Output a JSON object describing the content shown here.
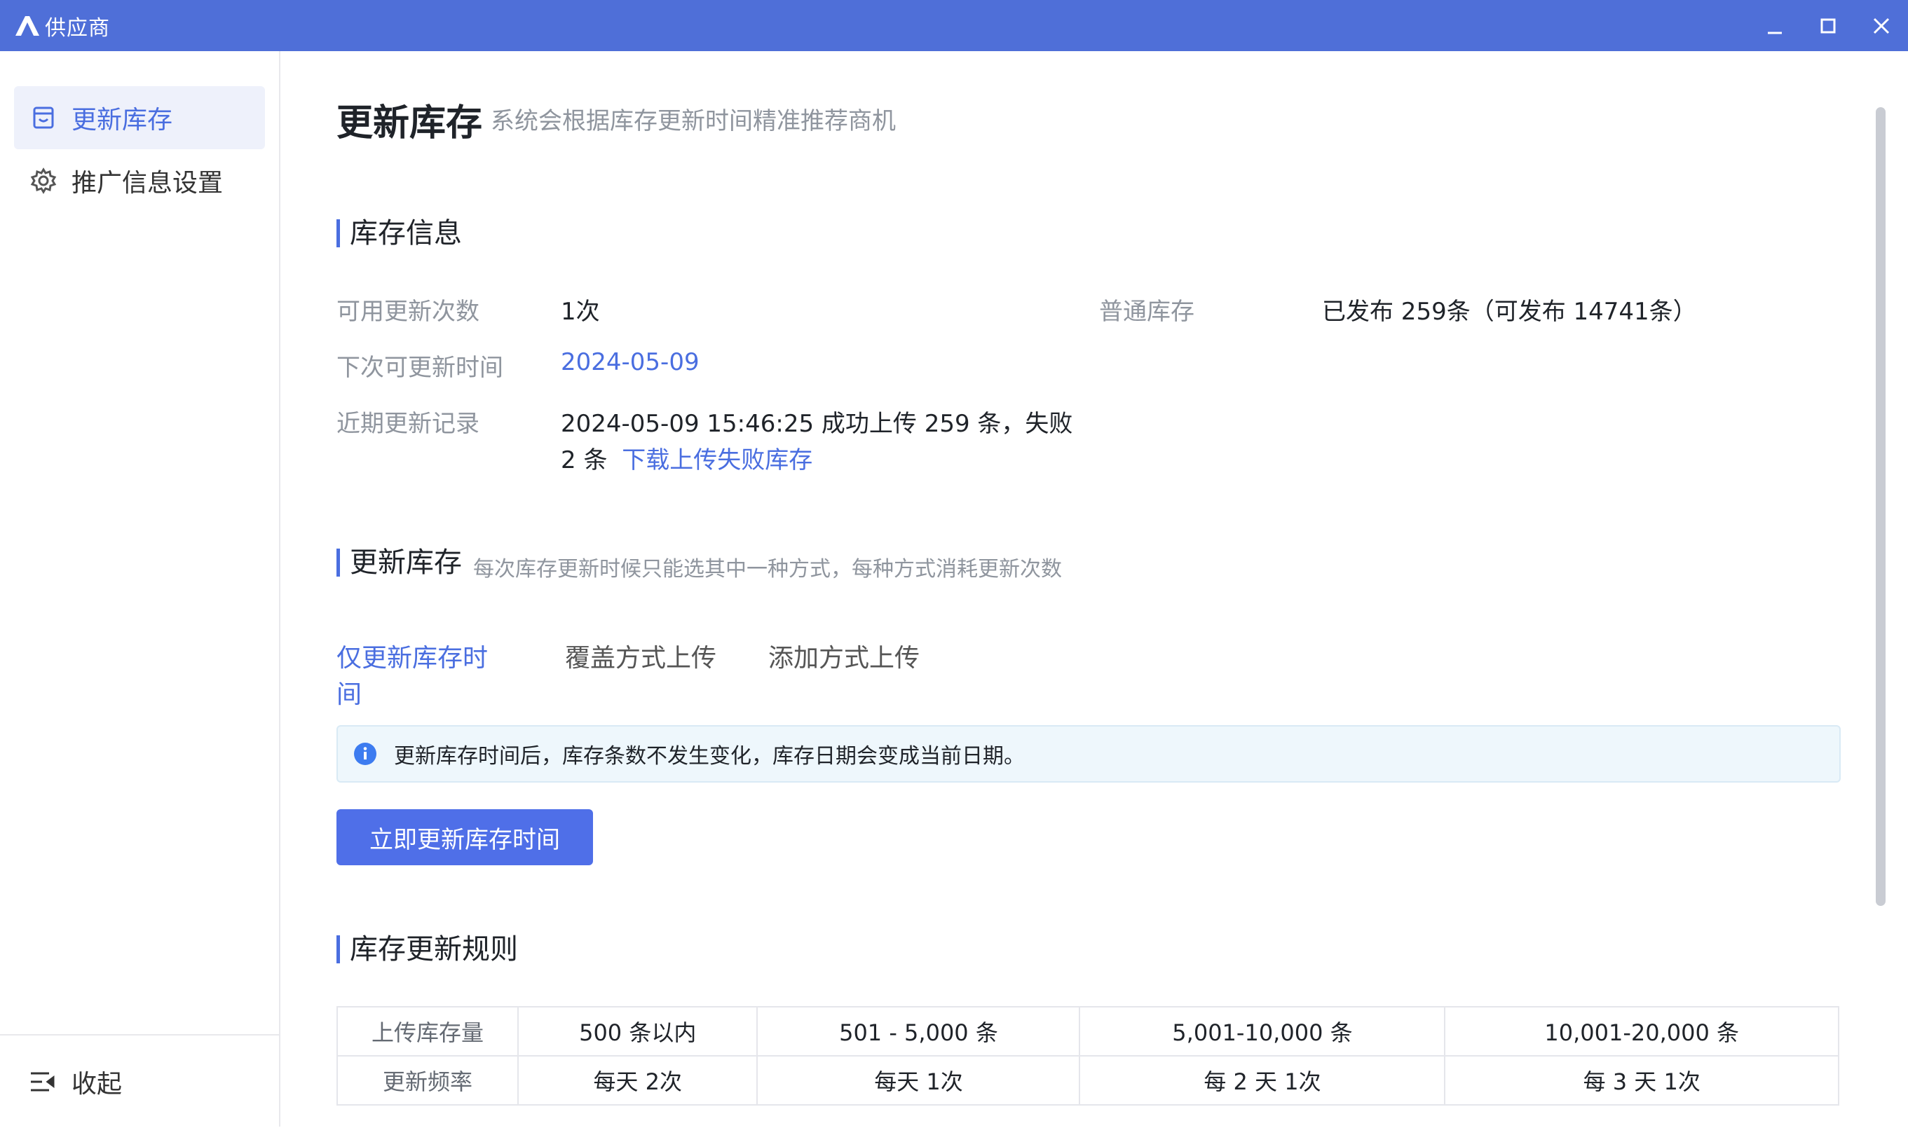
{
  "window": {
    "title": "供应商",
    "icons": {
      "logo": "brand-a-logo",
      "minimize": "minimize-icon",
      "maximize": "maximize-icon",
      "close": "close-icon"
    }
  },
  "sidebar": {
    "items": [
      {
        "label": "更新库存",
        "icon": "store-icon",
        "active": true
      },
      {
        "label": "推广信息设置",
        "icon": "gear-icon",
        "active": false
      }
    ],
    "collapse_label": "收起"
  },
  "header": {
    "title": "更新库存",
    "subtitle": "系统会根据库存更新时间精准推荐商机"
  },
  "inventory_info": {
    "section_title": "库存信息",
    "available_updates_label": "可用更新次数",
    "available_updates_value": "1次",
    "next_update_label": "下次可更新时间",
    "next_update_value": "2024-05-09",
    "recent_record_label": "近期更新记录",
    "recent_record_line1": "2024-05-09 15:46:25 成功上传 259 条，失败",
    "recent_record_line2": "2 条",
    "download_failed_link": "下载上传失败库存",
    "normal_stock_label": "普通库存",
    "normal_stock_value": "已发布 259条（可发布 14741条）"
  },
  "update_section": {
    "title": "更新库存",
    "subtitle": "每次库存更新时候只能选其中一种方式，每种方式消耗更新次数",
    "tabs": [
      {
        "label": "仅更新库存时间",
        "active": true
      },
      {
        "label": "覆盖方式上传",
        "active": false
      },
      {
        "label": "添加方式上传",
        "active": false
      }
    ],
    "notice": "更新库存时间后，库存条数不发生变化，库存日期会变成当前日期。",
    "action_button": "立即更新库存时间"
  },
  "rules": {
    "title": "库存更新规则",
    "row1_header": "上传库存量",
    "row1": [
      "500 条以内",
      "501 - 5,000 条",
      "5,001-10,000 条",
      "10,001-20,000 条"
    ],
    "row2_header": "更新频率",
    "row2": [
      "每天 2次",
      "每天 1次",
      "每 2 天 1次",
      "每 3 天 1次"
    ]
  },
  "colors": {
    "titlebar": "#4f6fd8",
    "accent": "#4a6ee0",
    "button": "#4f6fe8"
  }
}
